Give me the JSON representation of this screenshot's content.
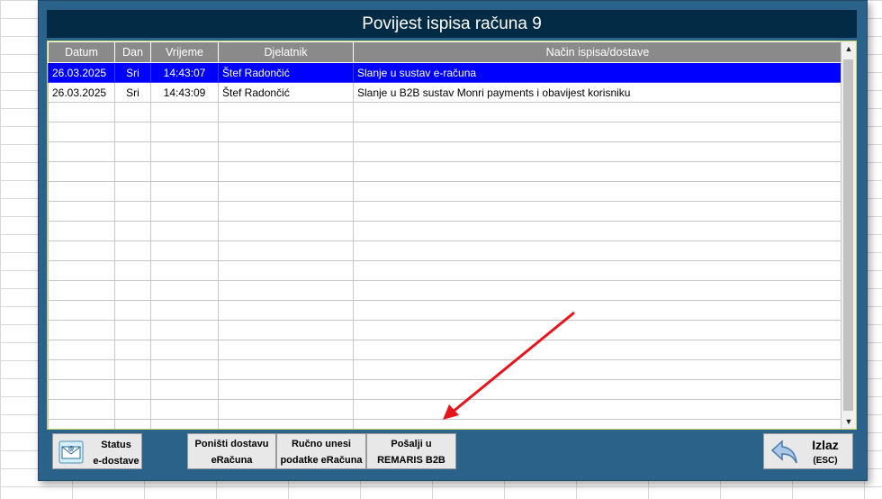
{
  "dialog": {
    "title": "Povijest ispisa računa 9"
  },
  "table": {
    "columns": [
      "Datum",
      "Dan",
      "Vrijeme",
      "Djelatnik",
      "Način ispisa/dostave"
    ],
    "rows": [
      [
        "26.03.2025",
        "Sri",
        "14:43:07",
        "Štef Radončić",
        "Slanje u sustav e-računa"
      ],
      [
        "26.03.2025",
        "Sri",
        "14:43:09",
        "Štef Radončić",
        "Slanje u B2B sustav Monri payments i obavijest korisniku"
      ]
    ],
    "selected_row": 0,
    "selected_color": "#0000fe",
    "empty_rows": 17
  },
  "buttons": {
    "status": {
      "line1": "Status",
      "line2": "e-dostave",
      "icon": "envelope-icon"
    },
    "cancel": {
      "line1": "Poništi dostavu",
      "line2": "eRačuna"
    },
    "manual": {
      "line1": "Ručno unesi",
      "line2": "podatke eRačuna"
    },
    "send": {
      "line1": "Pošalji u",
      "line2": "REMARIS B2B"
    },
    "exit": {
      "line1": "Izlaz",
      "line2": "(ESC)",
      "icon": "back-arrow-icon"
    }
  },
  "colors": {
    "dialog_bg": "#2a6289",
    "title_bg": "#032b45",
    "header_bg": "#8a8a8a",
    "annotation_arrow": "#e8141c"
  }
}
